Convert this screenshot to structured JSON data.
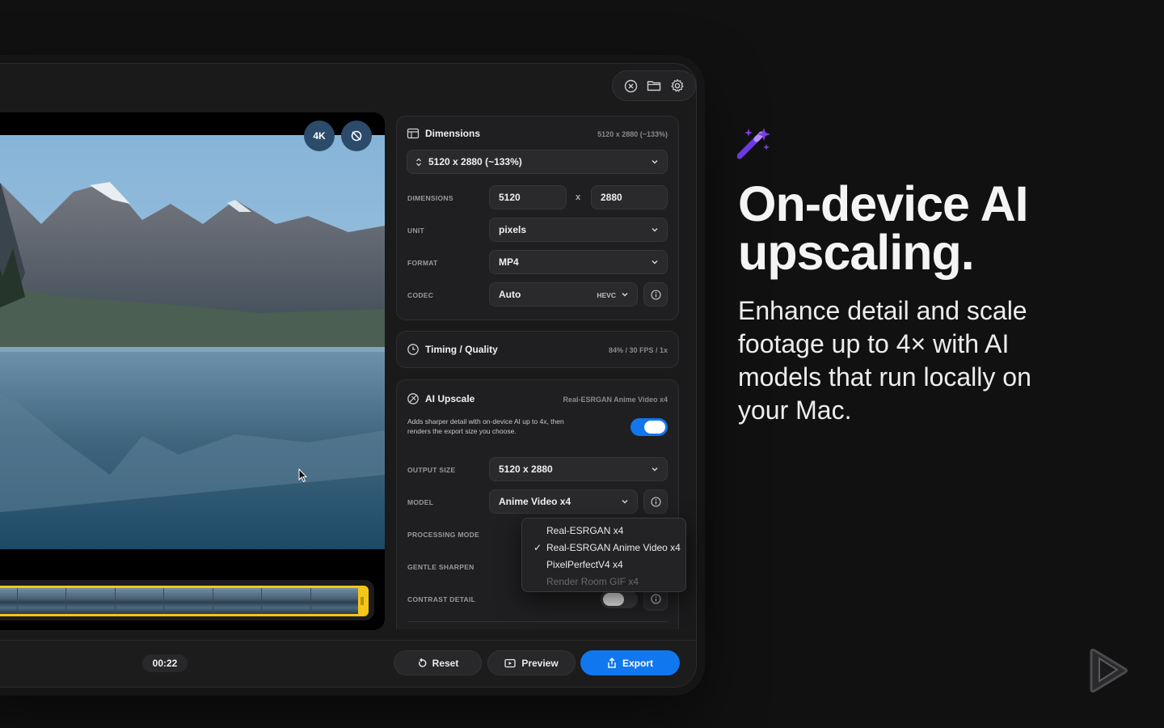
{
  "video": {
    "badge_4k": "4K",
    "time": "00:22"
  },
  "dimensions_card": {
    "title": "Dimensions",
    "meta": "5120 x 2880 (~133%)",
    "preset_value": "5120 x 2880 (~133%)",
    "dimensions_label": "DIMENSIONS",
    "width_value": "5120",
    "separator": "x",
    "height_value": "2880",
    "unit_label": "UNIT",
    "unit_value": "pixels",
    "format_label": "FORMAT",
    "format_value": "MP4",
    "codec_label": "CODEC",
    "codec_value": "Auto",
    "codec_variant": "HEVC"
  },
  "timing_card": {
    "title": "Timing / Quality",
    "meta": "84% / 30 FPS / 1x"
  },
  "upscale_card": {
    "title": "AI Upscale",
    "meta": "Real-ESRGAN Anime Video x4",
    "description_line1": "Adds sharper detail with on-device AI up to 4x, then",
    "description_line2": "renders the export size you choose.",
    "enabled": true,
    "output_size_label": "OUTPUT SIZE",
    "output_size_value": "5120 x 2880",
    "model_label": "MODEL",
    "model_value": "Anime Video x4",
    "processing_mode_label": "PROCESSING MODE",
    "gentle_sharpen_label": "GENTLE SHARPEN",
    "contrast_detail_label": "CONTRAST DETAIL",
    "contrast_detail_enabled": false
  },
  "model_menu": {
    "items": [
      {
        "label": "Real-ESRGAN x4",
        "checked": false,
        "disabled": false
      },
      {
        "label": "Real-ESRGAN Anime Video x4",
        "checked": true,
        "disabled": false
      },
      {
        "label": "PixelPerfectV4 x4",
        "checked": false,
        "disabled": false
      },
      {
        "label": "Render Room GIF x4",
        "checked": false,
        "disabled": true
      }
    ],
    "check_mark": "✓"
  },
  "actions": {
    "reset_label": "Reset",
    "preview_label": "Preview",
    "export_label": "Export"
  },
  "marketing": {
    "headline_line1": "On-device AI",
    "headline_line2": "upscaling.",
    "subtext_line1": "Enhance detail and scale",
    "subtext_line2": "footage up to 4× with AI",
    "subtext_line3": "models that run locally on",
    "subtext_line4": "your Mac."
  },
  "colors": {
    "accent_blue": "#1177ee",
    "timeline_yellow": "#f5c518",
    "magic_purple": "#7b3fe4"
  },
  "icons": [
    "close-circle-icon",
    "folder-icon",
    "gear-icon",
    "dimensions-icon",
    "timer-icon",
    "ai-upscale-icon",
    "magic-wand-icon",
    "play-logo-icon"
  ]
}
